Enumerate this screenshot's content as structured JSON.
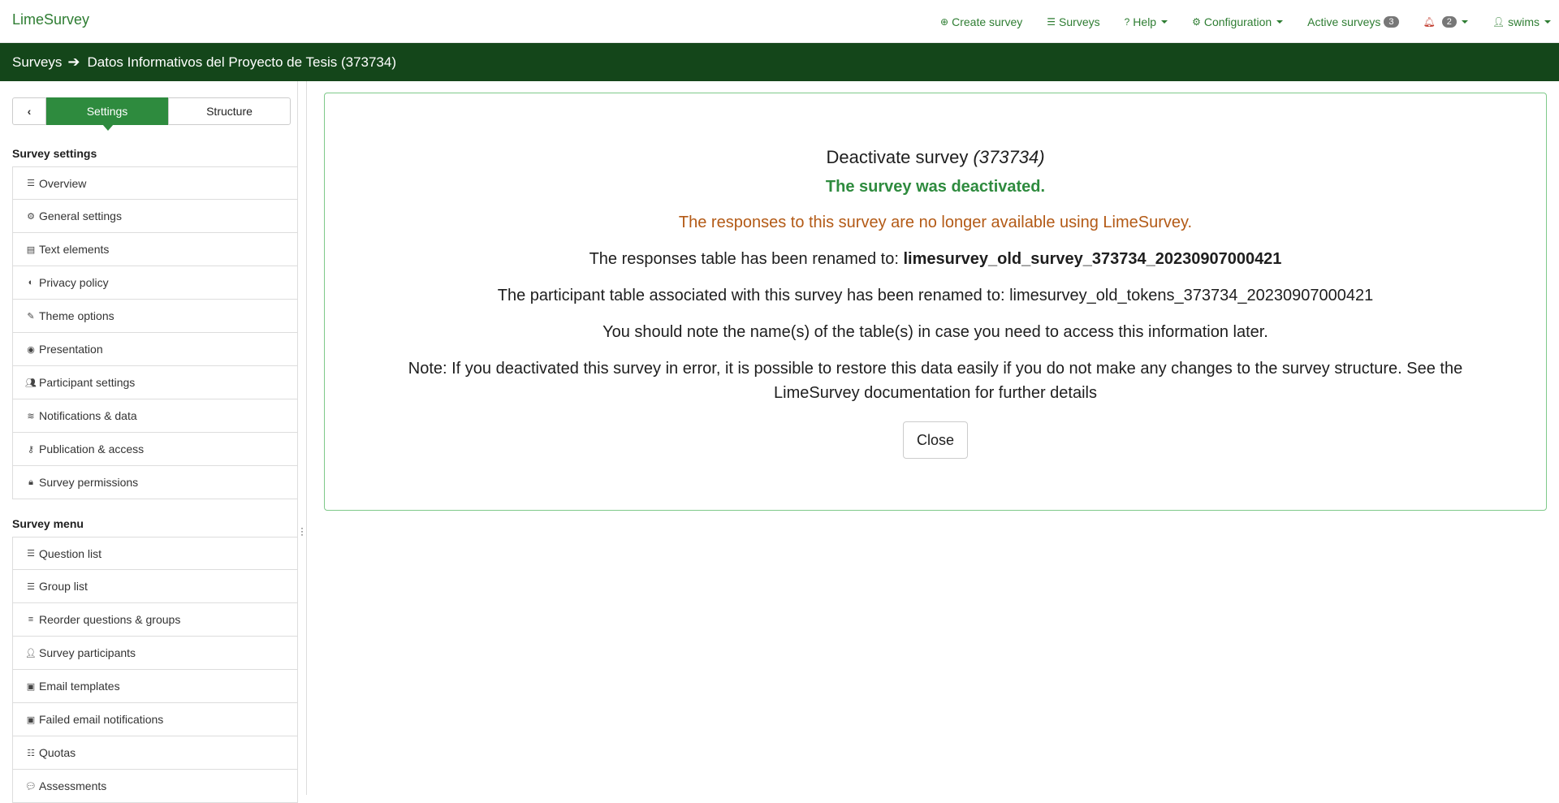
{
  "navbar": {
    "brand": "LimeSurvey",
    "create_survey": "Create survey",
    "surveys": "Surveys",
    "help": "Help",
    "configuration": "Configuration",
    "active_surveys": "Active surveys",
    "active_surveys_count": "3",
    "notifications_count": "2",
    "user": "swims"
  },
  "breadcrumb": {
    "root": "Surveys",
    "current": "Datos Informativos del Proyecto de Tesis (373734)"
  },
  "sidebar": {
    "tab_settings": "Settings",
    "tab_structure": "Structure",
    "settings_title": "Survey settings",
    "settings_items": [
      {
        "label": "Overview",
        "icon": "list-icon"
      },
      {
        "label": "General settings",
        "icon": "gears-icon"
      },
      {
        "label": "Text elements",
        "icon": "file-text-icon"
      },
      {
        "label": "Privacy policy",
        "icon": "shield-icon"
      },
      {
        "label": "Theme options",
        "icon": "brush-icon"
      },
      {
        "label": "Presentation",
        "icon": "eye-slash-icon"
      },
      {
        "label": "Participant settings",
        "icon": "users-icon"
      },
      {
        "label": "Notifications & data",
        "icon": "rss-icon"
      },
      {
        "label": "Publication & access",
        "icon": "key-icon"
      },
      {
        "label": "Survey permissions",
        "icon": "lock-icon"
      }
    ],
    "menu_title": "Survey menu",
    "menu_items": [
      {
        "label": "Question list",
        "icon": "list-icon"
      },
      {
        "label": "Group list",
        "icon": "list-icon"
      },
      {
        "label": "Reorder questions & groups",
        "icon": "bars-icon"
      },
      {
        "label": "Survey participants",
        "icon": "user-icon"
      },
      {
        "label": "Email templates",
        "icon": "envelope-icon"
      },
      {
        "label": "Failed email notifications",
        "icon": "envelope-icon"
      },
      {
        "label": "Quotas",
        "icon": "tasks-icon"
      },
      {
        "label": "Assessments",
        "icon": "comment-icon"
      }
    ]
  },
  "main": {
    "title": "Deactivate survey",
    "title_id": "(373734)",
    "success": "The survey was deactivated.",
    "warning": "The responses to this survey are no longer available using LimeSurvey.",
    "responses_prefix": "The responses table has been renamed to: ",
    "responses_table": "limesurvey_old_survey_373734_20230907000421",
    "participant_line": "The participant table associated with this survey has been renamed to: limesurvey_old_tokens_373734_20230907000421",
    "note_line": "You should note the name(s) of the table(s) in case you need to access this information later.",
    "restore_line_1": "Note: If you deactivated this survey in error, it is possible to restore this data easily if you do not make any changes to the survey structure. See the",
    "restore_line_2": "LimeSurvey documentation for further details",
    "close_button": "Close"
  }
}
